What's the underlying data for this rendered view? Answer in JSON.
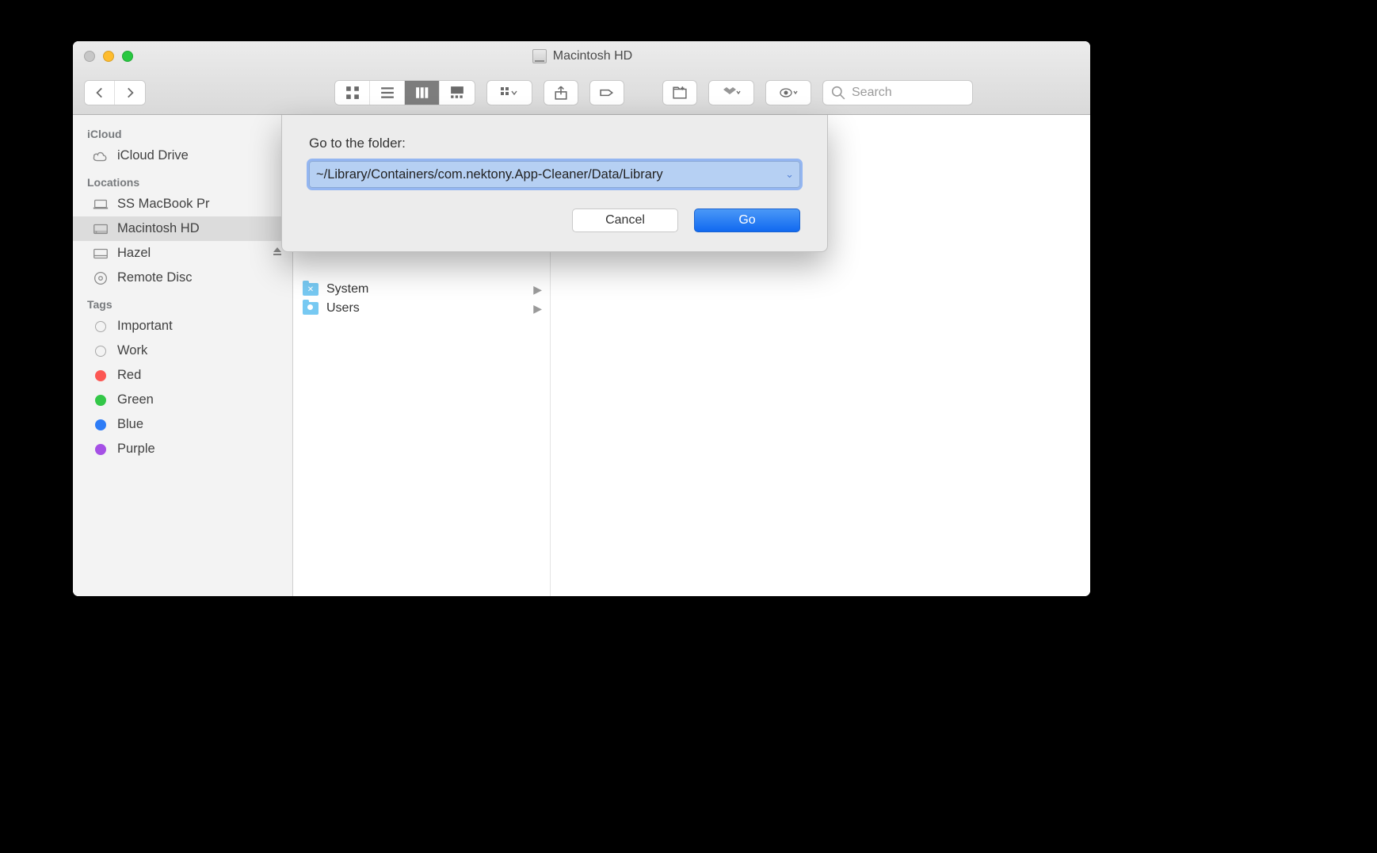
{
  "window": {
    "title": "Macintosh HD"
  },
  "toolbar": {
    "search_placeholder": "Search"
  },
  "sidebar": {
    "sections": {
      "icloud": {
        "title": "iCloud",
        "items": [
          {
            "label": "iCloud Drive"
          }
        ]
      },
      "locations": {
        "title": "Locations",
        "items": [
          {
            "label": "SS MacBook Pr"
          },
          {
            "label": "Macintosh HD"
          },
          {
            "label": "Hazel"
          },
          {
            "label": "Remote Disc"
          }
        ]
      },
      "tags": {
        "title": "Tags",
        "items": [
          {
            "label": "Important",
            "color": ""
          },
          {
            "label": "Work",
            "color": ""
          },
          {
            "label": "Red",
            "color": "#fc5753"
          },
          {
            "label": "Green",
            "color": "#33c748"
          },
          {
            "label": "Blue",
            "color": "#2e7cf6"
          },
          {
            "label": "Purple",
            "color": "#a550e5"
          }
        ]
      }
    }
  },
  "column": {
    "items": [
      {
        "label": "System"
      },
      {
        "label": "Users"
      }
    ]
  },
  "dialog": {
    "label": "Go to the folder:",
    "value": "~/Library/Containers/com.nektony.App-Cleaner/Data/Library",
    "cancel": "Cancel",
    "go": "Go"
  }
}
